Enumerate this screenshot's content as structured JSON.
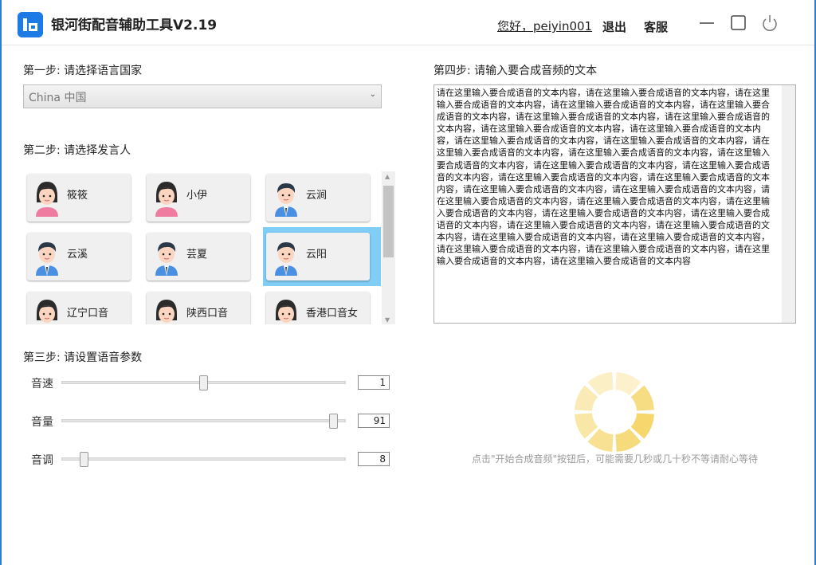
{
  "app": {
    "title": "银河街配音辅助工具V2.19",
    "greeting": "您好，peiyin001",
    "logout_label": "退出",
    "service_label": "客服"
  },
  "step1": {
    "label": "第一步: 请选择语言国家",
    "selected": "China 中国"
  },
  "step2": {
    "label": "第二步: 请选择发言人",
    "speakers": [
      {
        "name": "筱筱",
        "gender": "female",
        "selected": false
      },
      {
        "name": "小伊",
        "gender": "female",
        "selected": false
      },
      {
        "name": "云涧",
        "gender": "male",
        "selected": false
      },
      {
        "name": "云溪",
        "gender": "male",
        "selected": false
      },
      {
        "name": "芸夏",
        "gender": "male",
        "selected": false
      },
      {
        "name": "云阳",
        "gender": "male",
        "selected": true
      },
      {
        "name": "辽宁口音",
        "gender": "female",
        "selected": false
      },
      {
        "name": "陕西口音",
        "gender": "female",
        "selected": false
      },
      {
        "name": "香港口音女",
        "gender": "female",
        "selected": false
      }
    ]
  },
  "step3": {
    "label": "第三步: 请设置语音参数",
    "params": [
      {
        "label": "音速",
        "value": "1",
        "fraction": 0.5
      },
      {
        "label": "音量",
        "value": "91",
        "fraction": 0.96
      },
      {
        "label": "音调",
        "value": "8",
        "fraction": 0.08
      }
    ]
  },
  "step4": {
    "label": "第四步: 请输入要合成音频的文本",
    "text": "请在这里输入要合成语音的文本内容，请在这里输入要合成语音的文本内容，请在这里输入要合成语音的文本内容，请在这里输入要合成语音的文本内容，请在这里输入要合成语音的文本内容，请在这里输入要合成语音的文本内容，请在这里输入要合成语音的文本内容，请在这里输入要合成语音的文本内容，请在这里输入要合成语音的文本内容，请在这里输入要合成语音的文本内容，请在这里输入要合成语音的文本内容，请在这里输入要合成语音的文本内容，请在这里输入要合成语音的文本内容，请在这里输入要合成语音的文本内容，请在这里输入要合成语音的文本内容，请在这里输入要合成语音的文本内容，请在这里输入要合成语音的文本内容，请在这里输入要合成语音的文本内容，请在这里输入要合成语音的文本内容，请在这里输入要合成语音的文本内容，请在这里输入要合成语音的文本内容，请在这里输入要合成语音的文本内容，请在这里输入要合成语音的文本内容，请在这里输入要合成语音的文本内容，请在这里输入要合成语音的文本内容，请在这里输入要合成语音的文本内容，请在这里输入要合成语音的文本内容，请在这里输入要合成语音的文本内容，请在这里输入要合成语音的文本内容，请在这里输入要合成语音的文本内容，请在这里输入要合成语音的文本内容，请在这里输入要合成语音的文本内容，请在这里输入要合成语音的文本内容"
  },
  "hint": "点击\"开始合成音频\"按钮后，可能需要几秒或几十秒不等请耐心等待",
  "colors": {
    "accent": "#1e7be6",
    "selected_speaker": "#80cdf6",
    "spinner": "#f5d76e"
  }
}
